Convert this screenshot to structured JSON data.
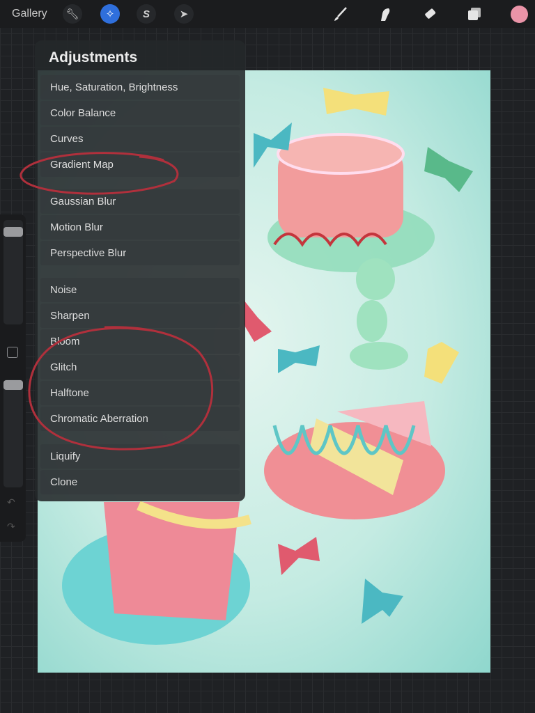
{
  "topbar": {
    "gallery": "Gallery",
    "left_icons": [
      "wrench-icon",
      "magic-wand-icon",
      "selection-s-icon",
      "arrow-cursor-icon"
    ],
    "active_icon": "magic-wand-icon",
    "right_icons": [
      "brush-icon",
      "smudge-icon",
      "eraser-icon",
      "layers-icon"
    ],
    "color": "#ea94a8"
  },
  "adjustments": {
    "title": "Adjustments",
    "groups": [
      [
        "Hue, Saturation, Brightness",
        "Color Balance",
        "Curves",
        "Gradient Map"
      ],
      [
        "Gaussian Blur",
        "Motion Blur",
        "Perspective Blur"
      ],
      [
        "Noise",
        "Sharpen",
        "Bloom",
        "Glitch",
        "Halftone",
        "Chromatic Aberration"
      ],
      [
        "Liquify",
        "Clone"
      ]
    ]
  },
  "annotations": {
    "color": "#b0303c"
  }
}
